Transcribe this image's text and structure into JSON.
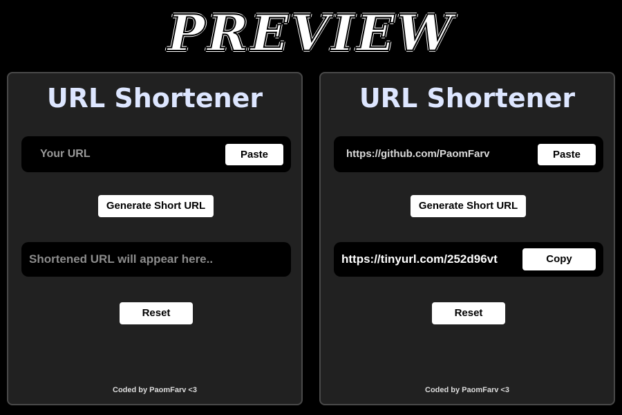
{
  "heading": "PREVIEW",
  "panels": [
    {
      "title": "URL Shortener",
      "input_value": "",
      "input_placeholder": "Your URL",
      "paste_label": "Paste",
      "generate_label": "Generate Short URL",
      "output_text": "Shortened URL will appear here..",
      "reset_label": "Reset",
      "footer": "Coded by PaomFarv <3"
    },
    {
      "title": "URL Shortener",
      "input_value": "https://github.com/PaomFarv",
      "paste_label": "Paste",
      "generate_label": "Generate Short URL",
      "output_text": "https://tinyurl.com/252d96vt",
      "copy_label": "Copy",
      "reset_label": "Reset",
      "footer": "Coded by PaomFarv <3"
    }
  ],
  "colors": {
    "page_background": "#000000",
    "panel_background": "#212121",
    "panel_border": "#4a4a4a",
    "title_color": "#dde6ff",
    "button_background": "#ffffff"
  }
}
